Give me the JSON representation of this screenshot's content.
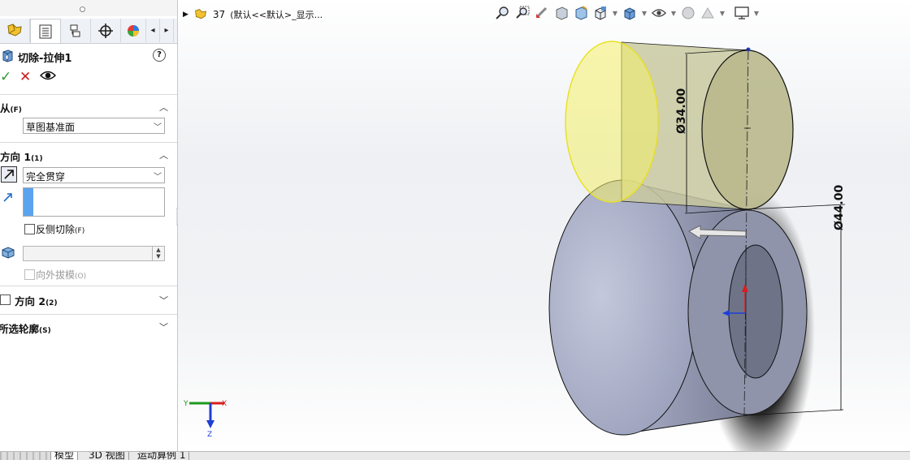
{
  "property_manager": {
    "tabs": [
      "feature-manager-icon",
      "property-manager-icon",
      "configuration-manager-icon",
      "dim-xpert-icon",
      "appearance-icon"
    ],
    "title": "切除-拉伸1",
    "help": "?",
    "ok": "✓",
    "cancel": "✕",
    "preview": "👁",
    "from": {
      "label": "从",
      "key": "(F)",
      "value": "草图基准面"
    },
    "direction1": {
      "label": "方向 1",
      "key": "(1)",
      "end_condition": "完全贯穿",
      "flip_side": "反侧切除",
      "flip_key": "(F)",
      "draft_outward": "向外拔模",
      "draft_key": "(O)"
    },
    "direction2": {
      "label": "方向 2",
      "key": "(2)"
    },
    "selected_contours": {
      "label": "所选轮廓",
      "key": "(S)"
    }
  },
  "viewport": {
    "tree_item": {
      "name": "37",
      "config": "(默认<<默认>_显示..."
    },
    "dimensions": {
      "upper": "Ø34.00",
      "lower": "Ø44.00"
    },
    "triad": {
      "x": "X",
      "y": "Y",
      "z": "Z"
    }
  },
  "bottom_tabs": [
    "模型",
    "3D 视图",
    "运动算例 1"
  ],
  "colors": {
    "check_green": "#2d9b2d",
    "cancel_red": "#c82020",
    "highlight_yellow": "#f4f06a",
    "cylinder_tan": "#c9c9a0",
    "body_blue": "#a7acc6"
  }
}
